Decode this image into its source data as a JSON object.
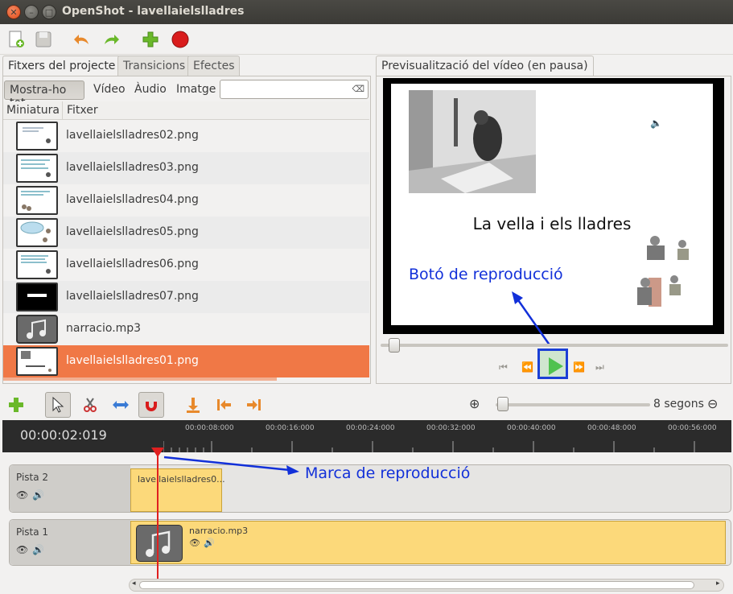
{
  "window": {
    "title": "OpenShot - lavellaielslladres"
  },
  "toolbar": {
    "icons": [
      "new-file-icon",
      "save-icon",
      "undo-icon",
      "redo-icon",
      "add-icon",
      "record-icon"
    ]
  },
  "tabs": {
    "files": "Fitxers del projecte",
    "transitions": "Transicions",
    "effects": "Efectes"
  },
  "filters": {
    "all": "Mostra-ho tot",
    "video": "Vídeo",
    "audio": "Àudio",
    "image": "Imatge",
    "search_placeholder": ""
  },
  "list": {
    "col_thumb": "Miniatura",
    "col_file": "Fitxer",
    "files": [
      "lavellaielslladres02.png",
      "lavellaielslladres03.png",
      "lavellaielslladres04.png",
      "lavellaielslladres05.png",
      "lavellaielslladres06.png",
      "lavellaielslladres07.png",
      "narracio.mp3",
      "lavellaielslladres01.png"
    ],
    "selected": "lavellaielslladres01.png"
  },
  "preview": {
    "tab": "Previsualització del vídeo (en pausa)",
    "slide_title": "La vella i els lladres",
    "annotation": "Botó de reproducció"
  },
  "timeline": {
    "zoom_label": "8 segons",
    "current_time": "00:00:02:019",
    "ticks": [
      "00:00:08:000",
      "00:00:16:000",
      "00:00:24:000",
      "00:00:32:000",
      "00:00:40:000",
      "00:00:48:000",
      "00:00:56:000"
    ],
    "annotation": "Marca de reproducció",
    "tracks": [
      {
        "name": "Pista 2",
        "clip": "lavellaielslladres0..."
      },
      {
        "name": "Pista 1",
        "clip": "narracio.mp3"
      }
    ]
  },
  "colors": {
    "accent": "#f07846",
    "annotation": "#1230d9",
    "clip": "#fcd97a",
    "playhead": "#e02020"
  }
}
